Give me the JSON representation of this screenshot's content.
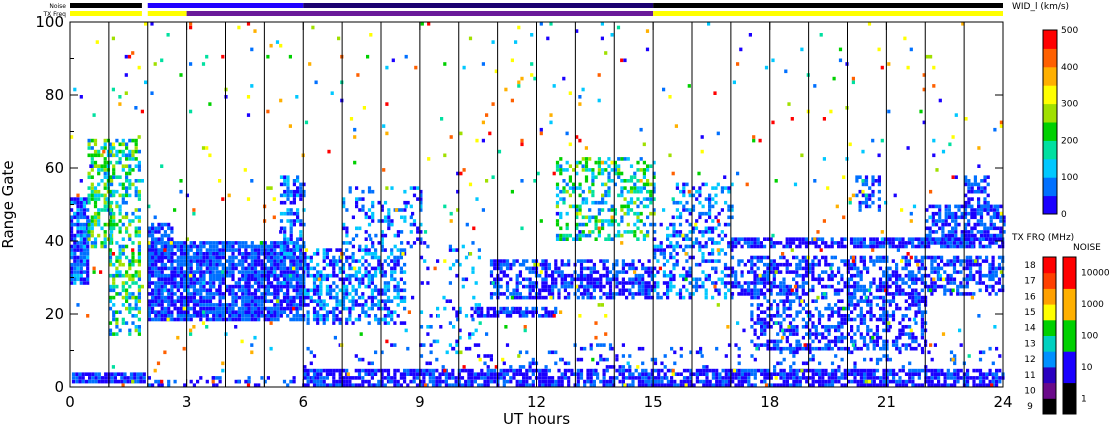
{
  "chart_data": {
    "type": "heatmap",
    "xlabel": "UT hours",
    "ylabel": "Range Gate",
    "xlim": [
      0,
      24
    ],
    "ylim": [
      0,
      100
    ],
    "x_ticks": [
      0,
      3,
      6,
      9,
      12,
      15,
      18,
      21,
      24
    ],
    "y_ticks": [
      0,
      20,
      40,
      60,
      80,
      100
    ],
    "hour_lines": [
      1,
      2,
      3,
      4,
      5,
      6,
      7,
      8,
      9,
      10,
      11,
      12,
      13,
      14,
      15,
      16,
      17,
      18,
      19,
      20,
      21,
      22,
      23
    ],
    "grid": false,
    "colorbar_main": {
      "label": "WID_l (km/s)",
      "min": 0,
      "max": 500,
      "ticks": [
        0,
        100,
        200,
        300,
        400,
        500
      ],
      "colors": [
        "#1a00ff",
        "#0070ff",
        "#00c8ff",
        "#00e0a0",
        "#00d000",
        "#a0e000",
        "#ffff00",
        "#ffb000",
        "#ff6000",
        "#ff0000"
      ]
    },
    "colorbar_txfreq": {
      "label": "TX FRQ (MHz)",
      "ticks": [
        9,
        10,
        11,
        12,
        13,
        14,
        15,
        16,
        17,
        18
      ],
      "colors": [
        "#000000",
        "#6a0a8a",
        "#2a00c0",
        "#0090ff",
        "#00d0c0",
        "#00d000",
        "#ffff00",
        "#ffa000",
        "#ff4000",
        "#ff0000"
      ]
    },
    "colorbar_noise": {
      "label": "NOISE",
      "ticks": [
        "1",
        "10",
        "100",
        "1000",
        "10000"
      ],
      "colors": [
        "#000000",
        "#1a00ff",
        "#00d000",
        "#ffb000",
        "#ff0000"
      ]
    },
    "top_bars": {
      "noise_label": "Noise",
      "txfreq_label": "TX Freq",
      "noise_segments": [
        {
          "start": 0.0,
          "end": 1.85,
          "color": "#000000"
        },
        {
          "start": 2.0,
          "end": 6.0,
          "color": "#2000ff"
        },
        {
          "start": 6.0,
          "end": 15.0,
          "color": "#1a0070"
        },
        {
          "start": 15.0,
          "end": 24.0,
          "color": "#000000"
        }
      ],
      "txfreq_segments": [
        {
          "start": 0.0,
          "end": 1.85,
          "color": "#ffff00"
        },
        {
          "start": 2.0,
          "end": 3.0,
          "color": "#ffff00"
        },
        {
          "start": 3.0,
          "end": 15.0,
          "color": "#6a1a9a"
        },
        {
          "start": 15.0,
          "end": 24.0,
          "color": "#ffff00"
        }
      ]
    },
    "scatter_bands": [
      {
        "t0": 0.05,
        "t1": 1.9,
        "g0": 1,
        "g1": 4,
        "density": 0.9,
        "cmin": 0.0,
        "cmax": 0.15
      },
      {
        "t0": 0.0,
        "t1": 0.45,
        "g0": 28,
        "g1": 52,
        "density": 0.85,
        "cmin": 0.0,
        "cmax": 0.25
      },
      {
        "t0": 0.45,
        "t1": 1.1,
        "g0": 38,
        "g1": 68,
        "density": 0.55,
        "cmin": 0.15,
        "cmax": 0.6
      },
      {
        "t0": 1.0,
        "t1": 1.8,
        "g0": 14,
        "g1": 68,
        "density": 0.45,
        "cmin": 0.1,
        "cmax": 0.6
      },
      {
        "t0": 2.0,
        "t1": 6.0,
        "g0": 18,
        "g1": 40,
        "density": 0.85,
        "cmin": 0.0,
        "cmax": 0.2
      },
      {
        "t0": 2.0,
        "t1": 2.6,
        "g0": 35,
        "g1": 45,
        "density": 0.7,
        "cmin": 0.0,
        "cmax": 0.2
      },
      {
        "t0": 5.4,
        "t1": 6.0,
        "g0": 35,
        "g1": 58,
        "density": 0.5,
        "cmin": 0.0,
        "cmax": 0.3
      },
      {
        "t0": 6.0,
        "t1": 8.6,
        "g0": 17,
        "g1": 38,
        "density": 0.55,
        "cmin": 0.0,
        "cmax": 0.3
      },
      {
        "t0": 7.0,
        "t1": 9.0,
        "g0": 38,
        "g1": 55,
        "density": 0.25,
        "cmin": 0.0,
        "cmax": 0.3
      },
      {
        "t0": 9.0,
        "t1": 10.5,
        "g0": 8,
        "g1": 40,
        "density": 0.12,
        "cmin": 0.0,
        "cmax": 0.3
      },
      {
        "t0": 10.8,
        "t1": 15.0,
        "g0": 24,
        "g1": 35,
        "density": 0.6,
        "cmin": 0.0,
        "cmax": 0.2
      },
      {
        "t0": 10.3,
        "t1": 12.5,
        "g0": 19,
        "g1": 22,
        "density": 0.7,
        "cmin": 0.0,
        "cmax": 0.15
      },
      {
        "t0": 12.5,
        "t1": 15.0,
        "g0": 40,
        "g1": 63,
        "density": 0.45,
        "cmin": 0.1,
        "cmax": 0.55
      },
      {
        "t0": 15.0,
        "t1": 17.0,
        "g0": 24,
        "g1": 45,
        "density": 0.4,
        "cmin": 0.0,
        "cmax": 0.3
      },
      {
        "t0": 15.5,
        "t1": 17.0,
        "g0": 45,
        "g1": 56,
        "density": 0.35,
        "cmin": 0.0,
        "cmax": 0.3
      },
      {
        "t0": 17.0,
        "t1": 24.0,
        "g0": 38,
        "g1": 41,
        "density": 0.8,
        "cmin": 0.0,
        "cmax": 0.15
      },
      {
        "t0": 17.0,
        "t1": 24.0,
        "g0": 25,
        "g1": 36,
        "density": 0.55,
        "cmin": 0.0,
        "cmax": 0.2
      },
      {
        "t0": 17.5,
        "t1": 22.0,
        "g0": 10,
        "g1": 25,
        "density": 0.5,
        "cmin": 0.0,
        "cmax": 0.2
      },
      {
        "t0": 22.0,
        "t1": 24.0,
        "g0": 40,
        "g1": 50,
        "density": 0.7,
        "cmin": 0.0,
        "cmax": 0.2
      },
      {
        "t0": 20.2,
        "t1": 20.8,
        "g0": 48,
        "g1": 58,
        "density": 0.5,
        "cmin": 0.0,
        "cmax": 0.2
      },
      {
        "t0": 23.0,
        "t1": 23.6,
        "g0": 48,
        "g1": 58,
        "density": 0.5,
        "cmin": 0.0,
        "cmax": 0.2
      },
      {
        "t0": 6.0,
        "t1": 24.0,
        "g0": 0,
        "g1": 5,
        "density": 0.75,
        "cmin": 0.0,
        "cmax": 0.15
      },
      {
        "t0": 2.0,
        "t1": 6.0,
        "g0": 0,
        "g1": 3,
        "density": 0.25,
        "cmin": 0.0,
        "cmax": 0.15
      },
      {
        "t0": 6.0,
        "t1": 24.0,
        "g0": 5,
        "g1": 12,
        "density": 0.12,
        "cmin": 0.0,
        "cmax": 0.2
      },
      {
        "t0": 0.0,
        "t1": 24.0,
        "g0": 0,
        "g1": 100,
        "density": 0.018,
        "cmin": 0.0,
        "cmax": 1.0
      }
    ]
  }
}
